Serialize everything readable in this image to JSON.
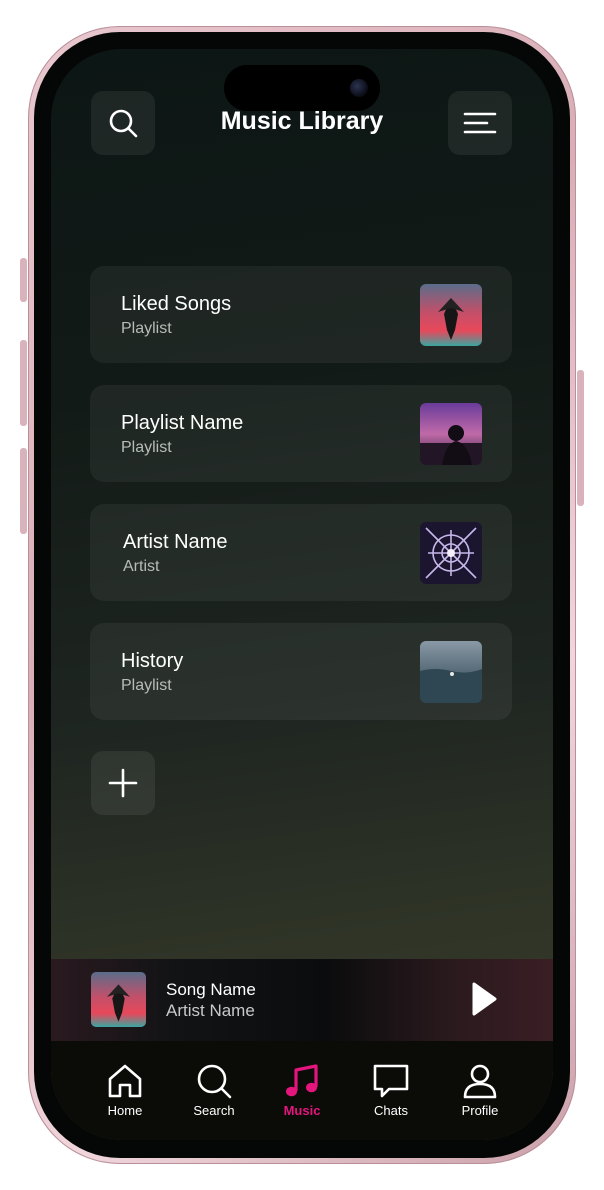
{
  "header": {
    "title": "Music Library",
    "search_icon": "search-icon",
    "menu_icon": "menu-icon"
  },
  "library": {
    "items": [
      {
        "title": "Liked Songs",
        "subtitle": "Playlist",
        "art": "pink-sunset-tree"
      },
      {
        "title": "Playlist Name",
        "subtitle": "Playlist",
        "art": "purple-silhouette"
      },
      {
        "title": "Artist Name",
        "subtitle": "Artist",
        "art": "kaleidoscope"
      },
      {
        "title": "History",
        "subtitle": "Playlist",
        "art": "ocean-swimmer"
      }
    ],
    "add_icon": "plus-icon"
  },
  "player": {
    "song": "Song Name",
    "artist": "Artist Name",
    "play_icon": "play-icon"
  },
  "tabs": [
    {
      "label": "Home",
      "icon": "home-icon",
      "active": false
    },
    {
      "label": "Search",
      "icon": "search-icon",
      "active": false
    },
    {
      "label": "Music",
      "icon": "music-note-icon",
      "active": true
    },
    {
      "label": "Chats",
      "icon": "chat-icon",
      "active": false
    },
    {
      "label": "Profile",
      "icon": "profile-icon",
      "active": false
    }
  ],
  "colors": {
    "accent": "#e4157d",
    "background_top": "#0c1614",
    "background_bottom": "#3a3b2a",
    "frame": "#e3bfc7"
  }
}
